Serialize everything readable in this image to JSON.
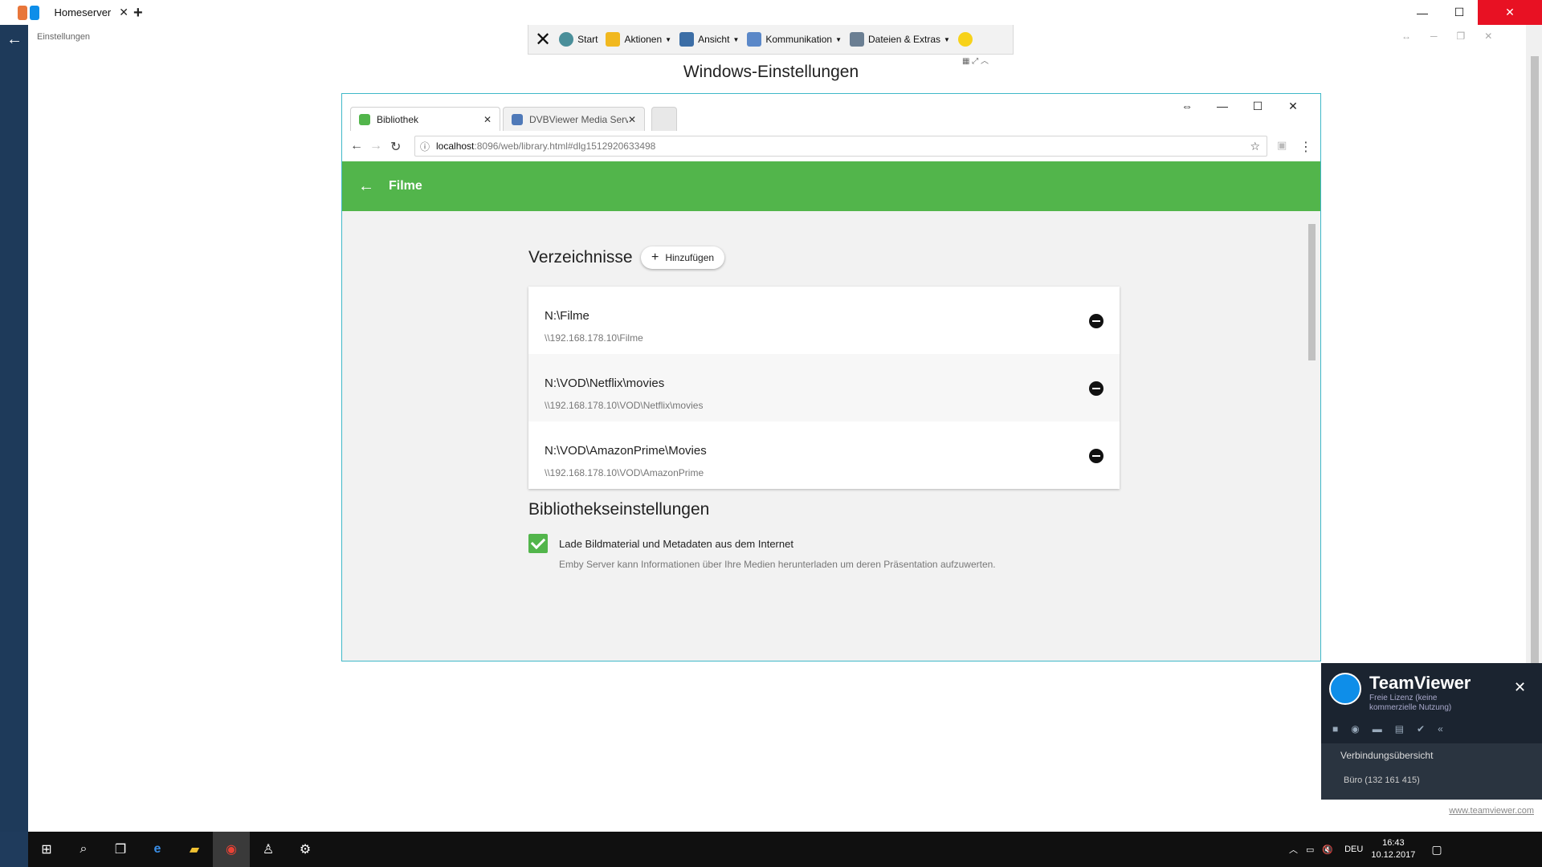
{
  "outer": {
    "tab_title": "Homeserver",
    "settings_label": "Einstellungen"
  },
  "toolbar": {
    "start": "Start",
    "aktionen": "Aktionen",
    "ansicht": "Ansicht",
    "kommunikation": "Kommunikation",
    "dateien": "Dateien & Extras"
  },
  "rdp_title": "Windows-Einstellungen",
  "chrome": {
    "tabs": [
      {
        "label": "Bibliothek"
      },
      {
        "label": "DVBViewer Media Server"
      }
    ],
    "url_host": "localhost",
    "url_rest": ":8096/web/library.html#dlg1512920633498"
  },
  "emby": {
    "header_title": "Filme",
    "section_folders": "Verzeichnisse",
    "add_button": "Hinzufügen",
    "folders": [
      {
        "path": "N:\\Filme",
        "unc": "\\\\192.168.178.10\\Filme"
      },
      {
        "path": "N:\\VOD\\Netflix\\movies",
        "unc": "\\\\192.168.178.10\\VOD\\Netflix\\movies"
      },
      {
        "path": "N:\\VOD\\AmazonPrime\\Movies",
        "unc": "\\\\192.168.178.10\\VOD\\AmazonPrime"
      }
    ],
    "section_library": "Bibliothekseinstellungen",
    "checkbox_label": "Lade Bildmaterial und Metadaten aus dem Internet",
    "checkbox_desc": "Emby Server kann Informationen über Ihre Medien herunterladen um deren Präsentation aufzuwerten.",
    "checkbox_checked": true
  },
  "teamviewer_panel": {
    "name": "TeamViewer",
    "subtitle": "Freie Lizenz (keine kommerzielle Nutzung)",
    "connections_label": "Verbindungsübersicht",
    "buero": "Büro (132 161 415)",
    "link": "www.teamviewer.com"
  },
  "taskbar": {
    "language": "DEU",
    "time": "16:43",
    "date": "10.12.2017"
  },
  "colors": {
    "emby_green": "#52b54b",
    "window_border": "#3fb8c8",
    "close_red": "#e81123"
  }
}
